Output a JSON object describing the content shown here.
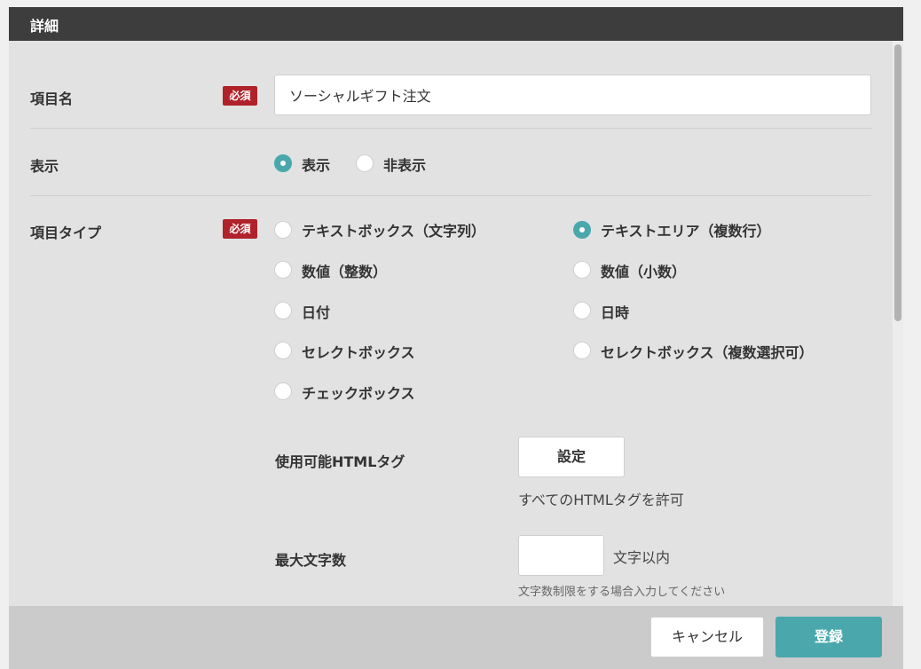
{
  "header": {
    "title": "詳細"
  },
  "form": {
    "item_name": {
      "label": "項目名",
      "required_badge": "必須",
      "value": "ソーシャルギフト注文"
    },
    "display": {
      "label": "表示",
      "options": [
        {
          "label": "表示",
          "checked": true
        },
        {
          "label": "非表示",
          "checked": false
        }
      ]
    },
    "item_type": {
      "label": "項目タイプ",
      "required_badge": "必須",
      "options": [
        {
          "label": "テキストボックス（文字列）",
          "checked": false
        },
        {
          "label": "テキストエリア（複数行）",
          "checked": true
        },
        {
          "label": "数値（整数）",
          "checked": false
        },
        {
          "label": "数値（小数）",
          "checked": false
        },
        {
          "label": "日付",
          "checked": false
        },
        {
          "label": "日時",
          "checked": false
        },
        {
          "label": "セレクトボックス",
          "checked": false
        },
        {
          "label": "セレクトボックス（複数選択可）",
          "checked": false
        },
        {
          "label": "チェックボックス",
          "checked": false
        }
      ]
    },
    "html_tags": {
      "label": "使用可能HTMLタグ",
      "button": "設定",
      "note": "すべてのHTMLタグを許可"
    },
    "max_chars": {
      "label": "最大文字数",
      "value": "",
      "suffix": "文字以内",
      "hint": "文字数制限をする場合入力してください"
    }
  },
  "footer": {
    "cancel": "キャンセル",
    "submit": "登録"
  },
  "colors": {
    "accent": "#4aa8ad",
    "badge": "#b0222a",
    "header": "#3d3d3d"
  }
}
